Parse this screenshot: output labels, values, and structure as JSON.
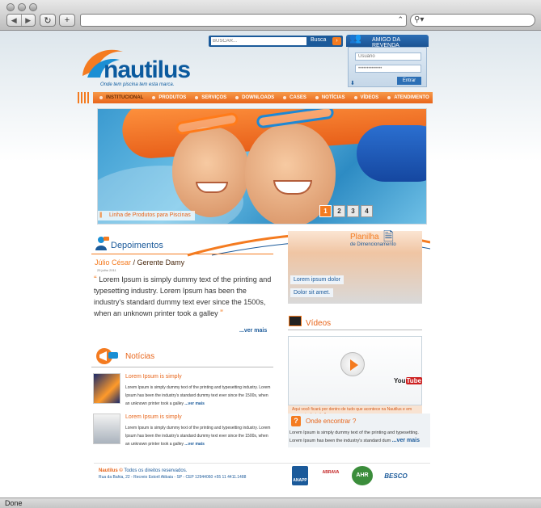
{
  "browser": {
    "status": "Done",
    "back_icon": "back-arrow-icon",
    "forward_icon": "forward-arrow-icon",
    "reload_icon": "reload-icon",
    "add_icon": "plus-icon",
    "search_icon": "magnifier-icon"
  },
  "header": {
    "logo_name": "nautilus",
    "logo_tagline": "Onde tem piscina tem esta marca.",
    "search_placeholder": "BUSCAR...",
    "search_button": "Busca",
    "amigo_label": "AMIGO DA REVENDA",
    "login_user_placeholder": "Usuário",
    "login_pass_value": "••••••••••••••",
    "login_button": "Entrar"
  },
  "menu": {
    "items": [
      {
        "label": "INSTITUCIONAL",
        "active": true
      },
      {
        "label": "PRODUTOS"
      },
      {
        "label": "SERVIÇOS"
      },
      {
        "label": "DOWNLOADS"
      },
      {
        "label": "CASES"
      },
      {
        "label": "NOTÍCIAS"
      },
      {
        "label": "VÍDEOS"
      },
      {
        "label": "ATENDIMENTO"
      }
    ]
  },
  "banner": {
    "caption": "Linha de Produtos para Piscinas",
    "pages": [
      "1",
      "2",
      "3",
      "4"
    ],
    "active_page": "1"
  },
  "depoimentos": {
    "title": "Depoimentos",
    "name": "Júlio César",
    "role": "/ Gerente Damy",
    "date": "25 julho 2011",
    "text": "Lorem Ipsum is simply dummy text of the printing and typesetting industry. Lorem Ipsum has been the industry's standard dummy text ever since the 1500s, when an unknown printer took a galley",
    "more": "...ver mais"
  },
  "planilha": {
    "title": "Planilha",
    "subtitle": "de Dimencionamento",
    "link1": "Lorem ipsum dolor",
    "link2": "Dolor sit amet."
  },
  "videos": {
    "title": "Vídeos",
    "youtube_label": "You",
    "youtube_tube": "Tube",
    "caption": "Aqui você ficará por dentro de tudo que acontece na Nautilus e em seu meio de trabalho."
  },
  "noticias": {
    "title": "Notícias",
    "items": [
      {
        "title": "Lorem Ipsum is simply",
        "text": "Lorem Ipsum is simply dummy text of the printing and typesetting industry. Lorem Ipsum has been the industry's standard dummy text ever since the 1500s, when an unknown printer took a galley",
        "more": "...ver mais"
      },
      {
        "title": "Lorem Ipsum is simply",
        "text": "Lorem Ipsum is simply dummy text of the printing and typesetting industry. Lorem Ipsum has been the industry's standard dummy text ever since the 1500s, when an unknown printer took a galley",
        "more": "...ver mais"
      }
    ]
  },
  "onde": {
    "title": "Onde encontrar ?",
    "text": "Lorem Ipsum is simply dummy text of the printing and typesetting. Lorem Ipsum has been the industry's standard dum",
    "more": "...ver mais"
  },
  "footer": {
    "brand": "Nautilus ©",
    "rights": " Todos os direitos reservados.",
    "address": "Rua da Bahia, 22 - Recreio Estoril Atibaia - SP - CEP 12944060 +55 11 4411.1488",
    "seals": [
      "ANAPP",
      "ABRAVA",
      "AHR",
      "BESCO"
    ]
  },
  "colors": {
    "brand_blue": "#1b5a9a",
    "brand_orange": "#f47b20"
  }
}
